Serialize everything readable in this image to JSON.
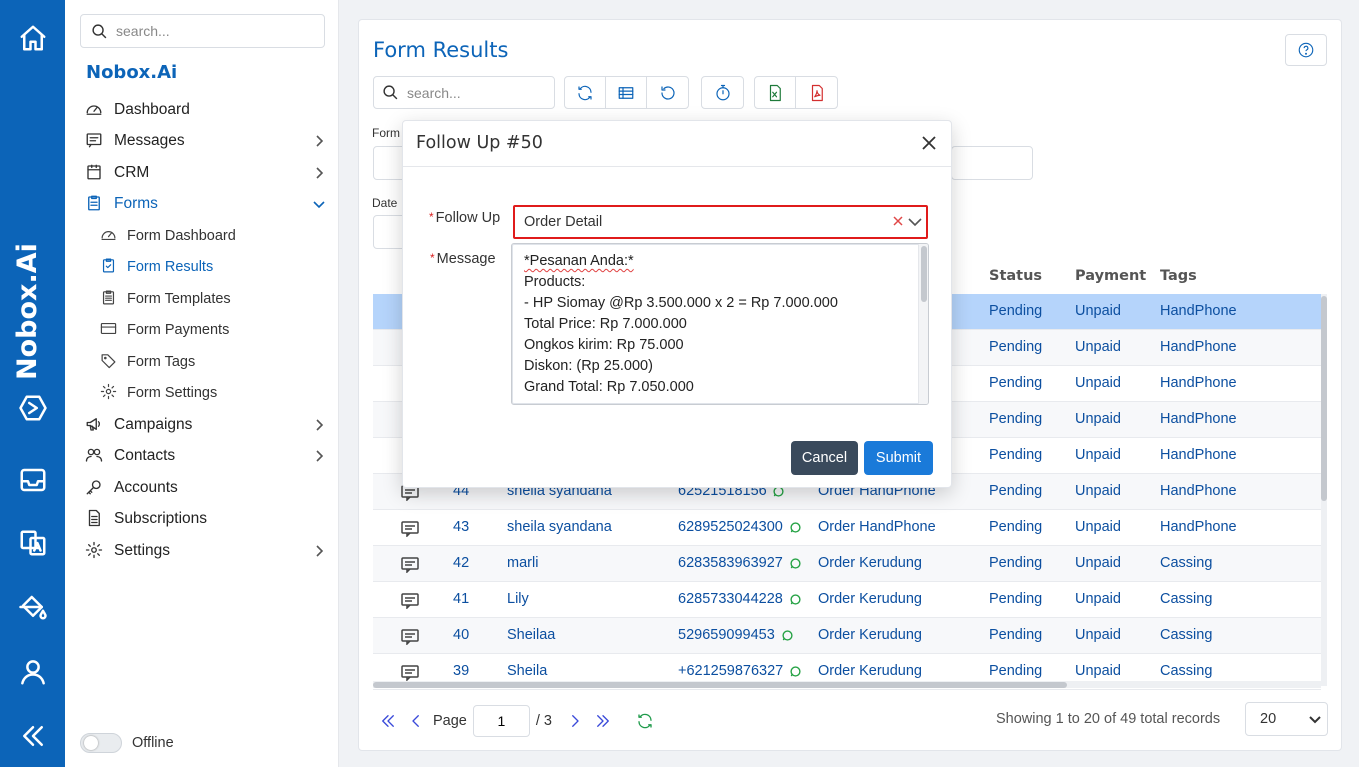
{
  "rail": {
    "brand": "Nobox.Ai",
    "icons": [
      "home-icon",
      "nobox-logo-icon",
      "inbox-icon",
      "translate-icon",
      "paint-bucket-icon",
      "user-icon",
      "collapse-icon"
    ]
  },
  "sidebar": {
    "search_placeholder": "search...",
    "title": "Nobox.Ai",
    "items": [
      {
        "label": "Dashboard",
        "icon": "gauge-icon"
      },
      {
        "label": "Messages",
        "icon": "message-icon"
      },
      {
        "label": "CRM",
        "icon": "crm-icon"
      },
      {
        "label": "Forms",
        "icon": "clipboard-icon"
      },
      {
        "label": "Campaigns",
        "icon": "megaphone-icon"
      },
      {
        "label": "Contacts",
        "icon": "contacts-icon"
      },
      {
        "label": "Accounts",
        "icon": "key-icon"
      },
      {
        "label": "Subscriptions",
        "icon": "document-icon"
      },
      {
        "label": "Settings",
        "icon": "gear-icon"
      }
    ],
    "sub_items": [
      {
        "label": "Form Dashboard",
        "icon": "gauge-icon"
      },
      {
        "label": "Form Results",
        "icon": "clipboard-check-icon"
      },
      {
        "label": "Form Templates",
        "icon": "clipboard-list-icon"
      },
      {
        "label": "Form Payments",
        "icon": "credit-card-icon"
      },
      {
        "label": "Form Tags",
        "icon": "tag-icon"
      },
      {
        "label": "Form Settings",
        "icon": "gear-icon"
      }
    ],
    "offline_label": "Offline"
  },
  "main": {
    "title": "Form Results",
    "search_placeholder": "search...",
    "filter_form_label": "Form",
    "filter_date_label": "Date",
    "columns": {
      "status": "Status",
      "payment": "Payment",
      "tags": "Tags"
    },
    "rows": [
      {
        "id": "",
        "name": "",
        "phone": "",
        "form": "",
        "status": "Pending",
        "payment": "Unpaid",
        "tag": "HandPhone"
      },
      {
        "id": "",
        "name": "",
        "phone": "",
        "form": "",
        "status": "Pending",
        "payment": "Unpaid",
        "tag": "HandPhone"
      },
      {
        "id": "",
        "name": "",
        "phone": "",
        "form": "",
        "status": "Pending",
        "payment": "Unpaid",
        "tag": "HandPhone"
      },
      {
        "id": "",
        "name": "",
        "phone": "",
        "form": "",
        "status": "Pending",
        "payment": "Unpaid",
        "tag": "HandPhone"
      },
      {
        "id": "",
        "name": "",
        "phone": "",
        "form": "",
        "status": "Pending",
        "payment": "Unpaid",
        "tag": "HandPhone"
      },
      {
        "id": "44",
        "name": "sheila syandana",
        "phone": "62521518156",
        "form": "Order HandPhone",
        "status": "Pending",
        "payment": "Unpaid",
        "tag": "HandPhone"
      },
      {
        "id": "43",
        "name": "sheila syandana",
        "phone": "6289525024300",
        "form": "Order HandPhone",
        "status": "Pending",
        "payment": "Unpaid",
        "tag": "HandPhone"
      },
      {
        "id": "42",
        "name": "marli",
        "phone": "6283583963927",
        "form": "Order Kerudung",
        "status": "Pending",
        "payment": "Unpaid",
        "tag": "Cassing"
      },
      {
        "id": "41",
        "name": "Lily",
        "phone": "6285733044228",
        "form": "Order Kerudung",
        "status": "Pending",
        "payment": "Unpaid",
        "tag": "Cassing"
      },
      {
        "id": "40",
        "name": "Sheilaa",
        "phone": "529659099453",
        "form": "Order Kerudung",
        "status": "Pending",
        "payment": "Unpaid",
        "tag": "Cassing"
      },
      {
        "id": "39",
        "name": "Sheila",
        "phone": "+621259876327",
        "form": "Order Kerudung",
        "status": "Pending",
        "payment": "Unpaid",
        "tag": "Cassing"
      }
    ],
    "pager": {
      "page_label": "Page",
      "page_value": "1",
      "total_pages": "/ 3",
      "showing": "Showing 1 to 20 of 49 total records",
      "per_page": "20"
    }
  },
  "modal": {
    "title": "Follow Up #50",
    "follow_up_label": "Follow Up",
    "follow_up_value": "Order Detail",
    "message_label": "Message",
    "message_lines": [
      "*Pesanan Anda:*",
      "Products:",
      "- HP Siomay @Rp 3.500.000 x 2 = Rp 7.000.000",
      "Total Price: Rp 7.000.000",
      "Ongkos kirim: Rp 75.000",
      "Diskon: (Rp 25.000)",
      "Grand Total: Rp 7.050.000"
    ],
    "cancel_label": "Cancel",
    "submit_label": "Submit"
  },
  "colors": {
    "brand": "#0c64b8",
    "selected_row": "#b5d4fb",
    "error_border": "#e01b1b",
    "submit": "#1a7ad9",
    "cancel": "#3a4a5c"
  }
}
